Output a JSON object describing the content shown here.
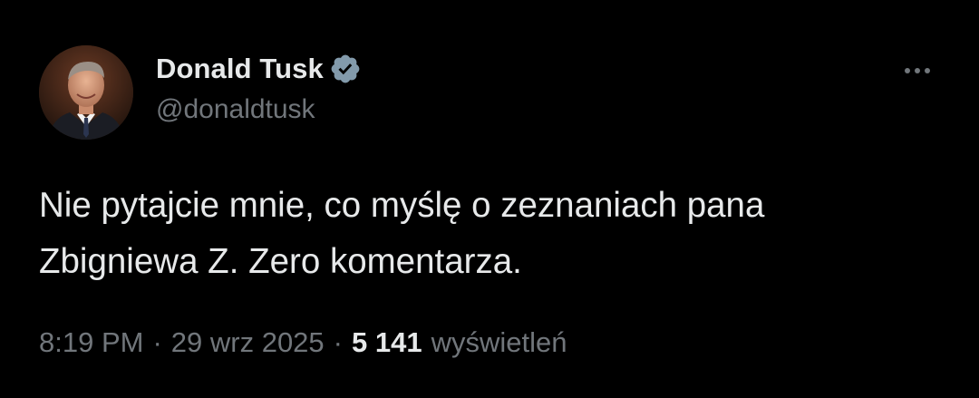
{
  "author": {
    "display_name": "Donald Tusk",
    "handle": "@donaldtusk",
    "verified_icon": "verified-badge-icon",
    "avatar_icon": "profile-photo"
  },
  "tweet": {
    "text": "Nie pytajcie mnie, co myślę o zeznaniach pana\nZbigniewa Z. Zero komentarza."
  },
  "meta": {
    "time": "8:19 PM",
    "separator": "·",
    "date": "29 wrz 2025",
    "views_count": "5 141",
    "views_label": "wyświetleń"
  },
  "menu": {
    "more_icon": "more-horizontal-icon"
  },
  "colors": {
    "background": "#000000",
    "primary_text": "#e7e9ea",
    "secondary_text": "#71767b",
    "verified_badge": "#829aab"
  }
}
